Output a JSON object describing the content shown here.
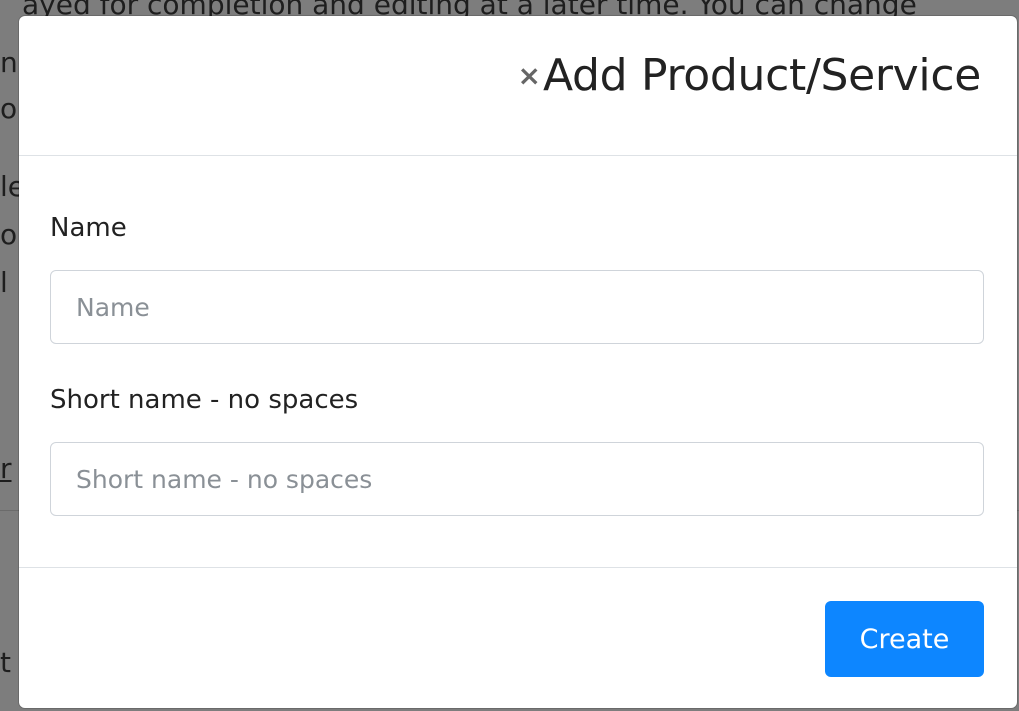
{
  "background": {
    "lines": [
      "ayed for completion and editing at a later time. You can change",
      "n",
      "o",
      "le",
      "ol",
      "l",
      "r",
      "t"
    ]
  },
  "modal": {
    "close_glyph": "×",
    "title": "Add Product/Service",
    "fields": [
      {
        "label": "Name",
        "placeholder": "Name",
        "value": ""
      },
      {
        "label": "Short name - no spaces",
        "placeholder": "Short name - no spaces",
        "value": ""
      }
    ],
    "submit_label": "Create"
  },
  "colors": {
    "primary": "#0d86ff",
    "backdrop": "#7d7d7d"
  }
}
